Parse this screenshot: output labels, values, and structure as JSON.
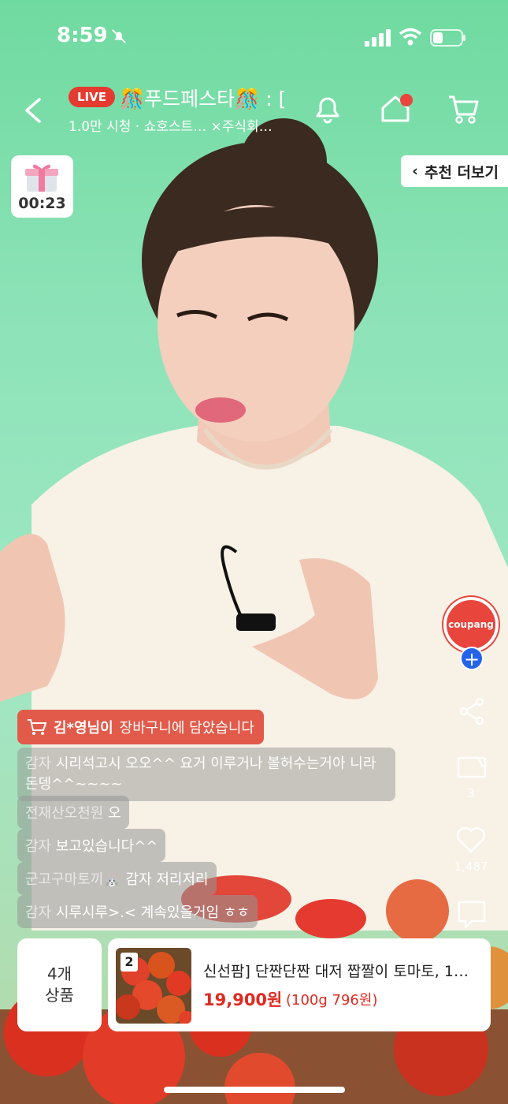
{
  "status_bar": {
    "time": "8:59"
  },
  "header": {
    "live_badge": "LIVE",
    "title": "🎊푸드페스타🎊 : [",
    "subtitle": "1.0만 시청 · 쇼호스트…  ×주식회…"
  },
  "gift": {
    "timer": "00:23"
  },
  "recommend": {
    "label": "추천 더보기"
  },
  "side": {
    "brand": "coupang",
    "clip_count": "3",
    "like_count": "1,487"
  },
  "chat": {
    "notice_user": "김*영님이",
    "notice_text": "장바구니에 담았습니다",
    "messages": [
      {
        "user": "감자",
        "text": "시리석고시 오오^^ 요거 이루거나 볼허수는거아 니라돈뎅^^~~~~"
      },
      {
        "user": "전재산오천원",
        "text": "오"
      },
      {
        "user": "감자",
        "text": "보고있습니다^^"
      },
      {
        "user": "군고구마토끼🐰",
        "text": "감자 저리저리"
      },
      {
        "user": "감자",
        "text": "시루시루>.< 계속있을거임 ㅎㅎ"
      }
    ]
  },
  "products": {
    "count_line1": "4개",
    "count_line2": "상품",
    "badge": "2",
    "name": "신선팜] 단짠단짠 대저 짭짤이 토마토, 1…",
    "price": "19,900원",
    "unit": "(100g 796원)"
  },
  "colors": {
    "live": "#e53a2f",
    "accent": "#e02a20",
    "notice": "#e15a4a",
    "coupang": "#e8453c"
  }
}
